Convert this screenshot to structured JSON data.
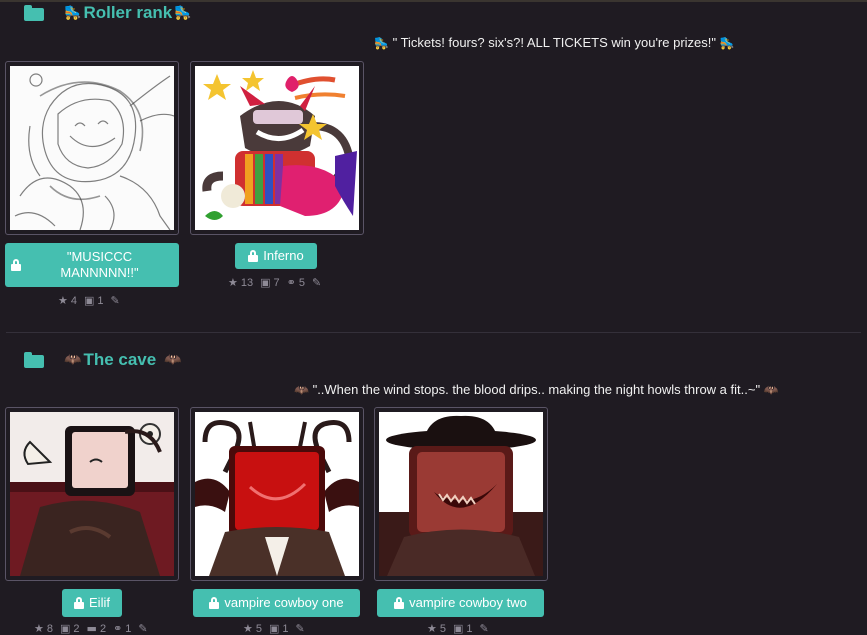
{
  "sections": [
    {
      "title": "Roller rank",
      "emoji": "🛼",
      "description": "\" Tickets! fours? six's?! ALL TICKETS win you're prizes!\"",
      "characters": [
        {
          "name": "\"MUSICCC MANNNNN!!\"",
          "stats": {
            "favorites": "4",
            "images": "1"
          }
        },
        {
          "name": "Inferno",
          "stats": {
            "favorites": "13",
            "images": "7",
            "links": "5"
          }
        }
      ]
    },
    {
      "title": "The cave",
      "emoji": "🦇",
      "description": "\"..When the wind stops. the blood drips.. making the night howls throw a fit..~\"",
      "characters": [
        {
          "name": "Eilif",
          "stats": {
            "favorites": "8",
            "images": "2",
            "comments": "2",
            "links": "1"
          }
        },
        {
          "name": "vampire cowboy one",
          "stats": {
            "favorites": "5",
            "images": "1"
          }
        },
        {
          "name": "vampire cowboy two",
          "stats": {
            "favorites": "5",
            "images": "1"
          }
        }
      ]
    }
  ],
  "icons": {
    "folder": "folder-icon",
    "lock": "lock-icon",
    "star": "star-icon",
    "image": "image-icon",
    "comment": "comment-icon",
    "link": "link-icon",
    "pencil": "pencil-icon"
  },
  "colors": {
    "background": "#1f1b22",
    "accent": "#45bfb0",
    "muted": "#8e8a96"
  }
}
